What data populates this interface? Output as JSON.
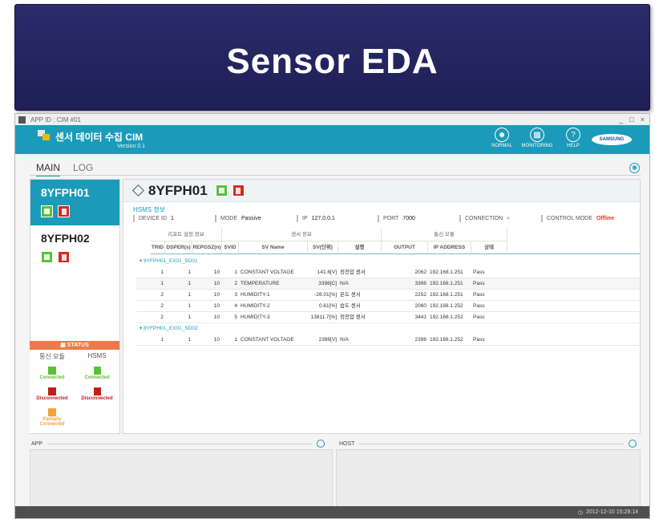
{
  "banner": {
    "title": "Sensor EDA"
  },
  "window": {
    "app_id_label": "APP ID : CIM #01",
    "controls": [
      "_",
      "□",
      "×"
    ],
    "title": "센서 데이터 수집 CIM",
    "version": "Version 0.1",
    "header_buttons": [
      {
        "label": "NORMAL",
        "icon": "user-icon"
      },
      {
        "label": "MONITORING",
        "icon": "monitor-icon"
      },
      {
        "label": "HELP",
        "icon": "help-icon"
      }
    ],
    "brand": "SAMSUNG"
  },
  "tabs": [
    {
      "label": "MAIN",
      "active": true
    },
    {
      "label": "LOG",
      "active": false
    }
  ],
  "devices": [
    {
      "name": "8YFPH01",
      "selected": true
    },
    {
      "name": "8YFPH02",
      "selected": false
    }
  ],
  "status_legend": {
    "title": "STATUS",
    "col1": "통신 모듈",
    "col2": "HSMS",
    "items": {
      "comm_connected": "Connected",
      "comm_disconnected": "Disconnected",
      "comm_partial_1": "Partially",
      "comm_partial_2": "Connected",
      "hsms_connected": "Connected",
      "hsms_disconnected": "Disconnected"
    },
    "colors": {
      "connected": "#5cbf3a",
      "disconnected": "#c0201b",
      "partial": "#f2a23a"
    }
  },
  "device_detail": {
    "title": "8YFPH01",
    "hsms_title": "HSMS 정보",
    "device_id_label": "DEVICE ID",
    "device_id": "1",
    "mode_label": "MODE",
    "mode": "Passive",
    "ip_label": "IP",
    "ip": "127.0.0.1",
    "port_label": "PORT",
    "port": "7000",
    "connection_label": "CONNECTION",
    "control_mode_label": "CONTROL MODE",
    "control_mode": "Offline"
  },
  "table": {
    "groups": [
      "리포트 설정 정보",
      "센서 정보",
      "통신 모듈"
    ],
    "headers": [
      "TRID",
      "DSPER(s)",
      "REPGSZ(n)",
      "SVID",
      "SV Name",
      "SV(단위)",
      "설명",
      "OUTPUT",
      "IP ADDRESS",
      "상태"
    ],
    "sections": [
      {
        "label": "8YFPH01_EX01_SD01",
        "rows": [
          {
            "trid": "1",
            "dsper": "1",
            "repgsz": "10",
            "svid": "1",
            "sv_name": "CONSTANT VOLTAGE",
            "sv": "141.6[V]",
            "desc": "정전압 센서",
            "output": "2062",
            "ip": "192.168.1.251",
            "state": "Pass"
          },
          {
            "trid": "1",
            "dsper": "1",
            "repgsz": "10",
            "svid": "2",
            "sv_name": "TEMPERATURE",
            "sv": "3398[C]",
            "desc": "N/A",
            "output": "3398",
            "ip": "192.168.1.251",
            "state": "Pass"
          },
          {
            "trid": "2",
            "dsper": "1",
            "repgsz": "10",
            "svid": "3",
            "sv_name": "HUMIDITY-1",
            "sv": "-28.01[%]",
            "desc": "온도 센서",
            "output": "2252",
            "ip": "192.168.1.251",
            "state": "Pass"
          },
          {
            "trid": "2",
            "dsper": "1",
            "repgsz": "10",
            "svid": "4",
            "sv_name": "HUMIDITY-2",
            "sv": "0.61[%]",
            "desc": "습도 센서",
            "output": "2060",
            "ip": "192.168.1.252",
            "state": "Pass"
          },
          {
            "trid": "2",
            "dsper": "1",
            "repgsz": "10",
            "svid": "5",
            "sv_name": "HUMIDITY-3",
            "sv": "13811.7[%]",
            "desc": "정전압 센서",
            "output": "3441",
            "ip": "192.168.1.252",
            "state": "Pass"
          }
        ]
      },
      {
        "label": "8YFPH01_EX01_SD02",
        "rows": [
          {
            "trid": "1",
            "dsper": "1",
            "repgsz": "10",
            "svid": "1",
            "sv_name": "CONSTANT VOLTAGE",
            "sv": "2396[V]",
            "desc": "N/A",
            "output": "2396",
            "ip": "192.168.1.252",
            "state": "Pass"
          }
        ]
      }
    ]
  },
  "bottom": {
    "app_label": "APP",
    "host_label": "HOST"
  },
  "statusbar": {
    "datetime": "2012-12-10 15:29:14"
  },
  "colors": {
    "accent": "#1b9bb9",
    "banner": "#24265f",
    "offline": "#e53b1e"
  }
}
